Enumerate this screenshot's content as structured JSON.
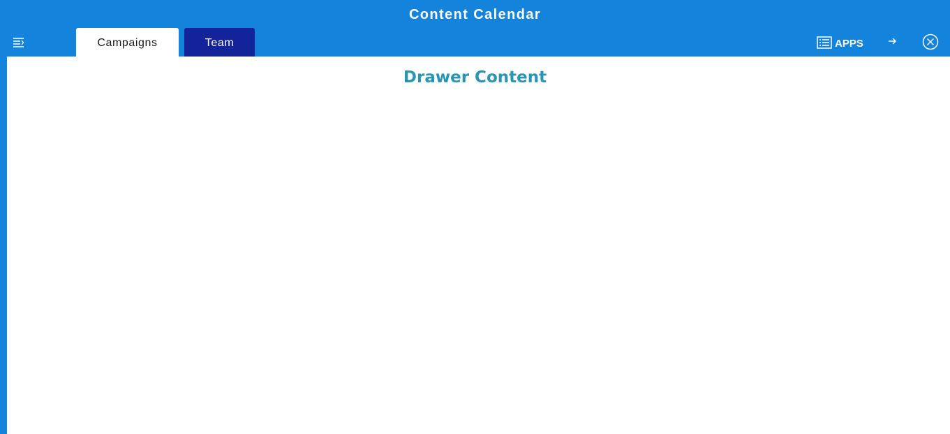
{
  "header": {
    "title": "Content Calendar",
    "menu_icon": "menu-collapse-icon",
    "apps_label": "APPS",
    "apps_icon": "list-icon",
    "forward_icon": "arrow-right-icon",
    "close_icon": "close-circle-icon"
  },
  "tabs": [
    {
      "label": "Campaigns",
      "active": true
    },
    {
      "label": "Team",
      "active": false
    }
  ],
  "drawer": {
    "title": "Drawer Content"
  },
  "colors": {
    "header_bg": "#1383dc",
    "active_tab_bg": "#ffffff",
    "inactive_tab_bg": "#13239a",
    "drawer_title": "#2795b5"
  }
}
